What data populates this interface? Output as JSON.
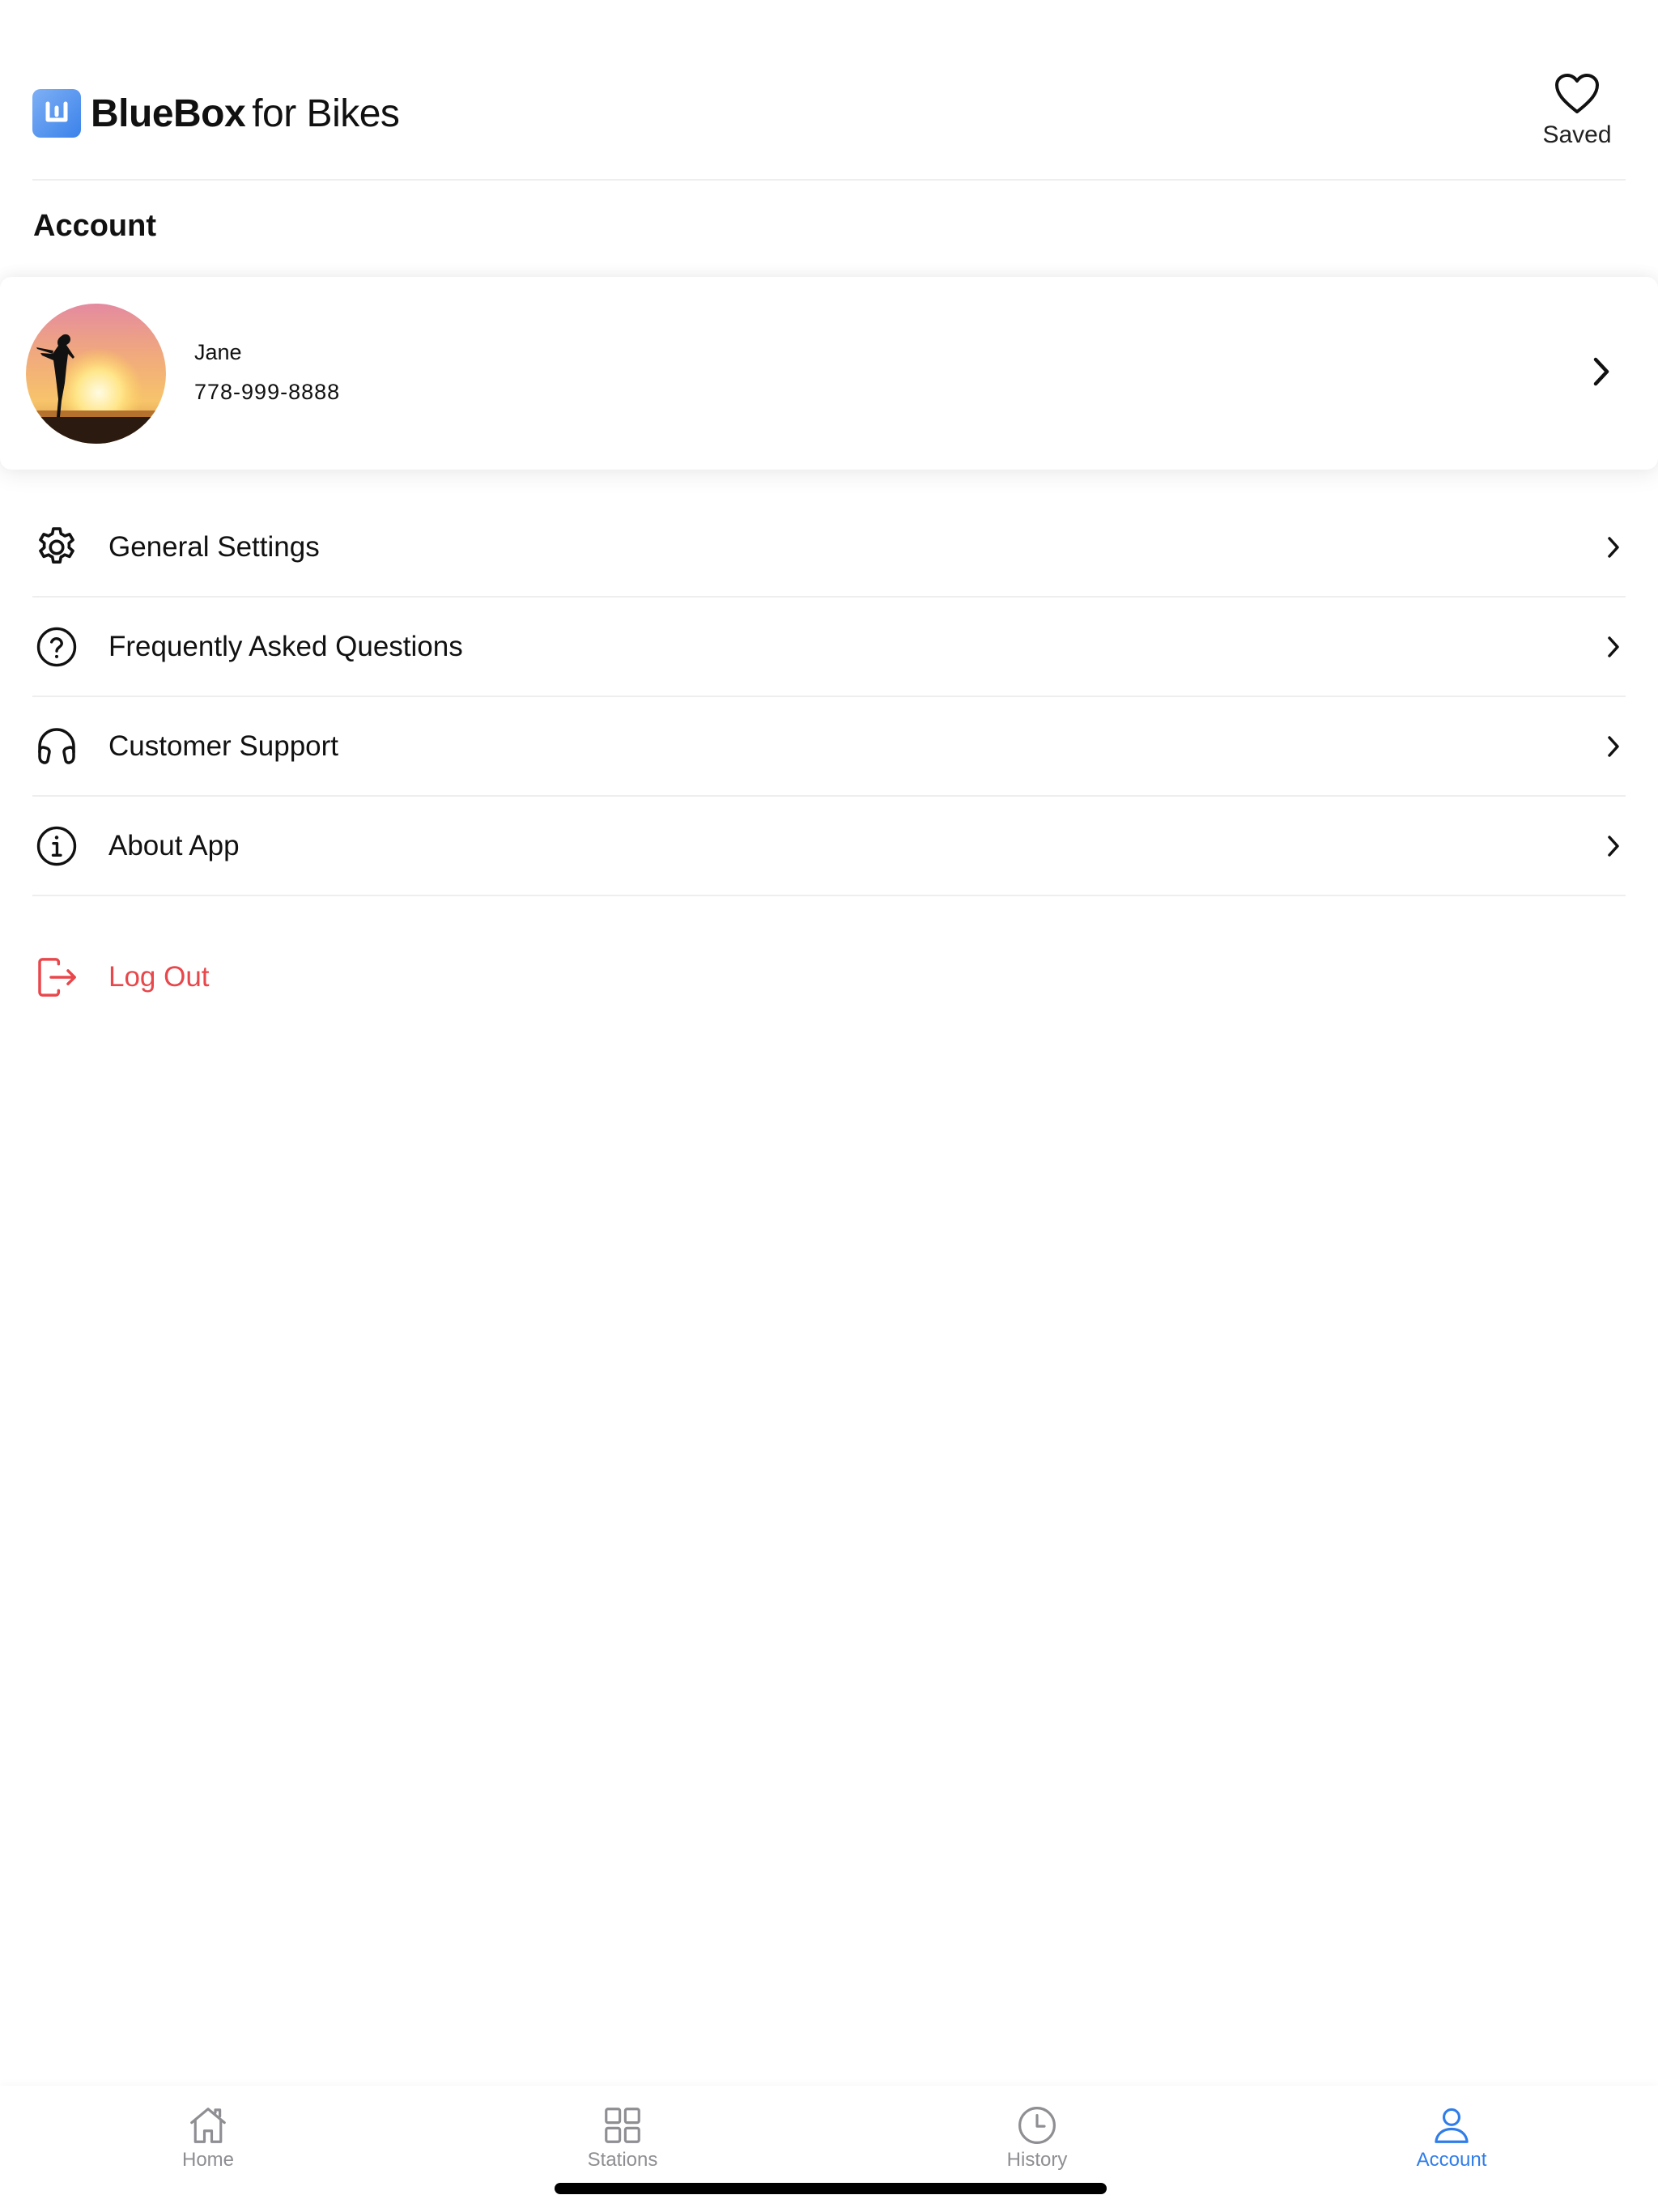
{
  "header": {
    "brand": "BlueBox",
    "brand_suffix": "for Bikes",
    "saved_label": "Saved"
  },
  "page": {
    "title": "Account"
  },
  "profile": {
    "name": "Jane",
    "phone": "778-999-8888"
  },
  "menu": {
    "items": [
      {
        "label": "General Settings",
        "icon": "gear-icon"
      },
      {
        "label": "Frequently Asked Questions",
        "icon": "question-circle-icon"
      },
      {
        "label": "Customer Support",
        "icon": "headphones-icon"
      },
      {
        "label": "About App",
        "icon": "info-circle-icon"
      }
    ],
    "logout_label": "Log Out"
  },
  "tabs": [
    {
      "label": "Home",
      "icon": "home-icon",
      "active": false
    },
    {
      "label": "Stations",
      "icon": "grid-icon",
      "active": false
    },
    {
      "label": "History",
      "icon": "clock-icon",
      "active": false
    },
    {
      "label": "Account",
      "icon": "user-icon",
      "active": true
    }
  ],
  "colors": {
    "accent": "#2f7de9",
    "danger": "#e8474b",
    "inactive": "#8e8e93",
    "logo_gradient_start": "#7fb0f5",
    "logo_gradient_end": "#3a82ea"
  }
}
